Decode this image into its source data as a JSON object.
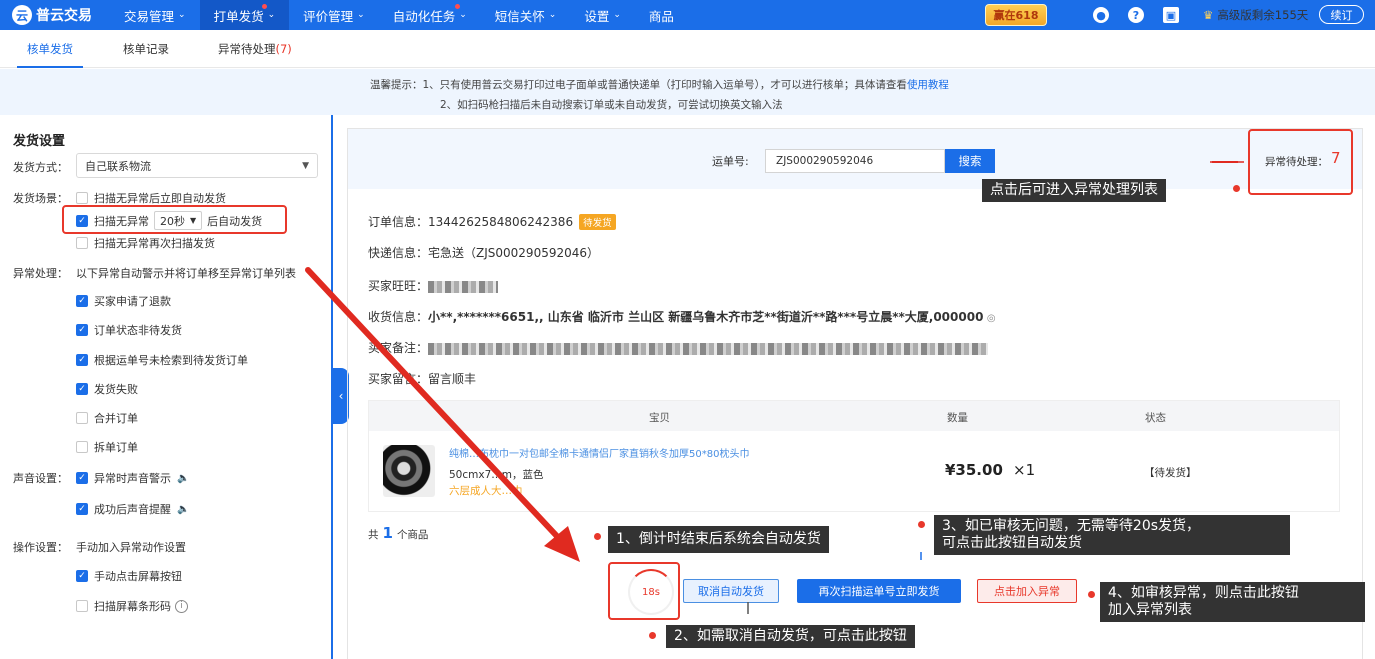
{
  "nav": {
    "logo_text": "普云交易",
    "items": [
      {
        "label": "交易管理",
        "caret": "⌄",
        "dot": false,
        "active": false
      },
      {
        "label": "打单发货",
        "caret": "⌄",
        "dot": true,
        "active": true
      },
      {
        "label": "评价管理",
        "caret": "⌄",
        "dot": false,
        "active": false
      },
      {
        "label": "自动化任务",
        "caret": "⌄",
        "dot": true,
        "active": false
      },
      {
        "label": "短信关怀",
        "caret": "⌄",
        "dot": false,
        "active": false
      },
      {
        "label": "设置",
        "caret": "⌄",
        "dot": false,
        "active": false
      },
      {
        "label": "商品",
        "caret": "",
        "dot": false,
        "active": false
      }
    ],
    "promo": "赢在618",
    "vip": "高级版剩余155天",
    "renew": "续订",
    "icons": [
      "notification-icon",
      "help-icon",
      "message-icon"
    ]
  },
  "subtabs": {
    "tab1": "核单发货",
    "tab2": "核单记录",
    "tab3": "异常待处理",
    "tab3_count": "(7)"
  },
  "notice": {
    "line1": "温馨提示：1、只有使用普云交易打印过电子面单或普通快递单（打印时输入运单号），才可以进行核单；具体请查看",
    "line1_link": "使用教程",
    "line2": "2、如扫码枪扫描后未自动搜索订单或未自动发货，可尝试切换英文输入法"
  },
  "settings": {
    "title": "发货设置",
    "ship_method_label": "发货方式：",
    "ship_method_value": "自己联系物流",
    "scene_label": "发货场景：",
    "scene_opt1": "扫描无异常后立即自动发货",
    "scene_opt2_pre": "扫描无异常",
    "scene_opt2_sel": "20秒",
    "scene_opt2_post": "后自动发货",
    "scene_opt3": "扫描无异常再次扫描发货",
    "abnormal_label": "异常处理：",
    "abnormal_desc": "以下异常自动警示并将订单移至异常订单列表",
    "abn_opts": [
      {
        "label": "买家申请了退款",
        "checked": true
      },
      {
        "label": "订单状态非待发货",
        "checked": true
      },
      {
        "label": "根据运单号未检索到待发货订单",
        "checked": true
      },
      {
        "label": "发货失败",
        "checked": true
      },
      {
        "label": "合并订单",
        "checked": false
      },
      {
        "label": "拆单订单",
        "checked": false
      }
    ],
    "sound_label": "声音设置：",
    "sound_opt1": "异常时声音警示",
    "sound_opt2": "成功后声音提醒",
    "op_label": "操作设置：",
    "op_desc": "手动加入异常动作设置",
    "op_opt1": "手动点击屏幕按钮",
    "op_opt2": "扫描屏幕条形码"
  },
  "search": {
    "label": "运单号:",
    "value": "ZJS000290592046",
    "button": "搜索",
    "abn_label": "异常待处理：",
    "abn_count": "7"
  },
  "order": {
    "order_label": "订单信息：",
    "order_no": "1344262584806242386",
    "order_tag": "待发货",
    "express_label": "快递信息：",
    "express_value": "宅急送（ZJS000290592046）",
    "buyer_label": "买家旺旺：",
    "address_label": "收货信息：",
    "address_value": "小**,*******6651,, 山东省 临沂市 兰山区 新疆乌鲁木齐市芝**街道沂**路***号立晨**大厦,000000",
    "remark_label": "买家备注：",
    "msg_label": "买家留言：",
    "msg_value": "留言顺丰"
  },
  "goods": {
    "head_item": "宝贝",
    "head_qty": "数量",
    "head_status": "状态",
    "title": "纯棉…布枕巾一对包邮全棉卡通情侣厂家直销秋冬加厚50*80枕头巾",
    "spec": "50cmx7…m，蓝色",
    "gift": "六层成人大…巾",
    "price": "¥35.00",
    "qty": "×1",
    "status": "【待发货】",
    "total_pre": "共",
    "total_num": "1",
    "total_post": "个商品"
  },
  "actions": {
    "timer": "18s",
    "cancel": "取消自动发货",
    "rescan": "再次扫描运单号立即发货",
    "add_abnormal": "点击加入异常"
  },
  "callouts": {
    "c_abn": "点击后可进入异常处理列表",
    "c1": "1、倒计时结束后系统会自动发货",
    "c2": "2、如需取消自动发货，可点击此按钮",
    "c3_l1": "3、如已审核无问题，无需等待20s发货，",
    "c3_l2": "可点击此按钮自动发货",
    "c4_l1": "4、如审核异常，则点击此按钮",
    "c4_l2": "加入异常列表"
  },
  "colors": {
    "primary": "#1b6ee8",
    "danger": "#e8382b",
    "warning": "#f5a623"
  }
}
